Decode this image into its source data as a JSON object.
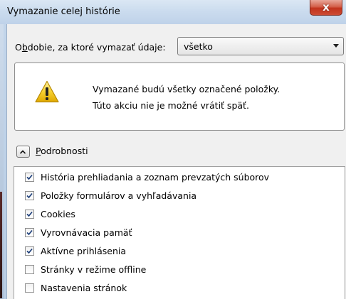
{
  "window": {
    "title": "Vymazanie celej histórie",
    "close_glyph": "x"
  },
  "period": {
    "label_pre": "O",
    "label_accel": "b",
    "label_post": "dobie, za ktoré vymazať údaje:",
    "selected": "všetko"
  },
  "warning": {
    "line1": "Vymazané budú všetky označené položky.",
    "line2": "Túto akciu nie je možné vrátiť späť.",
    "icon": "warning-triangle-icon"
  },
  "details": {
    "label_accel": "P",
    "label_post": "odrobnosti",
    "expanded": true
  },
  "items": [
    {
      "label": "História prehliadania a zoznam prevzatých súborov",
      "checked": true
    },
    {
      "label": "Položky formulárov a vyhľadávania",
      "checked": true
    },
    {
      "label": "Cookies",
      "checked": true
    },
    {
      "label": "Vyrovnávacia pamäť",
      "checked": true
    },
    {
      "label": "Aktívne prihlásenia",
      "checked": true
    },
    {
      "label": "Stránky v režime offline",
      "checked": false
    },
    {
      "label": "Nastavenia stránok",
      "checked": false
    }
  ]
}
